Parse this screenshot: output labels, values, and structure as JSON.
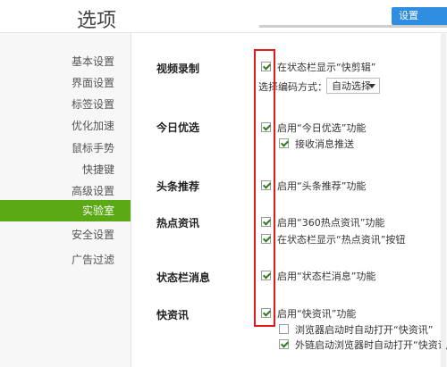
{
  "header": {
    "title": "选项",
    "button_label": "设置"
  },
  "sidebar": {
    "items": [
      {
        "label": "基本设置"
      },
      {
        "label": "界面设置"
      },
      {
        "label": "标签设置"
      },
      {
        "label": "优化加速"
      },
      {
        "label": "鼠标手势"
      },
      {
        "label": "快捷键"
      },
      {
        "label": "高级设置"
      },
      {
        "label": "实验室"
      },
      {
        "label": "安全设置"
      },
      {
        "label": "广告过滤"
      }
    ],
    "active_index": 7,
    "accent": "#5aa915"
  },
  "sections": {
    "video": {
      "title": "视频录制",
      "option": "在状态栏显示“快剪辑”",
      "encoding_label": "选择编码方式：",
      "encoding_value": "自动选择"
    },
    "today": {
      "title": "今日优选",
      "option": "启用“今日优选”功能",
      "sub_option": "接收消息推送"
    },
    "headline": {
      "title": "头条推荐",
      "option": "启用“头条推荐”功能"
    },
    "hot": {
      "title": "热点资讯",
      "option": "启用“360热点资讯”功能",
      "sub_option": "在状态栏显示“热点资讯”按钮"
    },
    "statusbar": {
      "title": "状态栏消息",
      "option": "启用“状态栏消息”功能"
    },
    "quicknews": {
      "title": "快资讯",
      "option": "启用“快资讯”功能",
      "sub_option_1": "浏览器启动时自动打开“快资讯”",
      "sub_option_2": "外链启动浏览器时自动打开“快资讯”"
    }
  },
  "highlight_color": "#e01b1b"
}
